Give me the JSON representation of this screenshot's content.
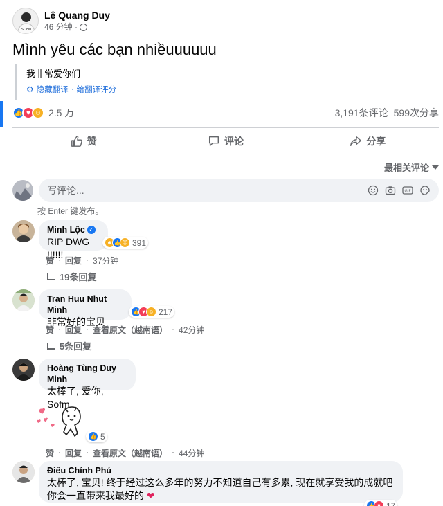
{
  "post": {
    "author": "Lê Quang Duy",
    "time": "46 分钟 ·",
    "text": "Mình yêu các bạn nhiềuuuuuu",
    "translation": {
      "text": "我非常爱你们",
      "hide_label": "隐藏翻译",
      "separator": "·",
      "rate_label": "给翻译评分"
    },
    "reactions_count": "2.5 万",
    "comments_count": "3,191条评论",
    "shares_count": "599次分享",
    "avatar_text": "SOFM"
  },
  "actions": {
    "like": "赞",
    "comment": "评论",
    "share": "分享"
  },
  "sort_label": "最相关评论",
  "composer": {
    "placeholder": "写评论...",
    "hint": "按 Enter 键发布。",
    "gif_label": "GIF"
  },
  "comments": [
    {
      "author": "Minh Lộc",
      "text": "RIP DWG !!!!!!",
      "react_count": "391",
      "actions": [
        "赞",
        "回复",
        "37分钟"
      ],
      "replies": "19条回复"
    },
    {
      "author": "Tran Huu Nhut Minh",
      "text": "非常好的宝贝",
      "react_count": "217",
      "actions": [
        "赞",
        "回复",
        "查看原文（越南语）",
        "42分钟"
      ],
      "replies": "5条回复"
    },
    {
      "author": "Hoàng Tùng Duy Minh",
      "text": "太棒了, 爱你, Sofm",
      "react_count": "5",
      "actions": [
        "赞",
        "回复",
        "查看原文（越南语）",
        "44分钟"
      ]
    },
    {
      "author": "Điêu Chính Phú",
      "text_line1": "太棒了, 宝贝! 终于经过这么多年的努力不知道自己有多累, 现在就享受我的成就吧",
      "text_line2": "你会一直带来我最好的",
      "react_count": "17"
    }
  ],
  "colors": {
    "facebook_blue": "#1877f2",
    "love_red": "#f33e58",
    "care_yellow": "#f7b125",
    "muted_text": "#65676b",
    "bubble_bg": "#f0f2f5"
  }
}
